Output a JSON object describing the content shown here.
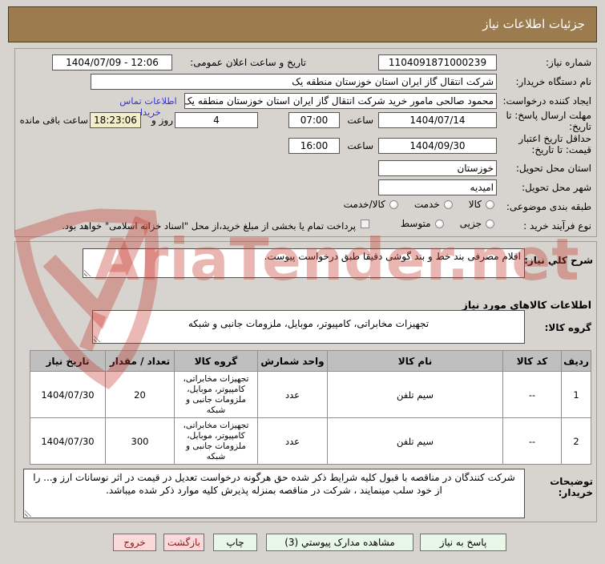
{
  "title": "جزئیات اطلاعات نیاز",
  "watermark": {
    "text": "AriaTender.net"
  },
  "form": {
    "need_number_label": "شماره نیاز:",
    "need_number": "1104091871000239",
    "announce_label": "تاریخ و ساعت اعلان عمومی:",
    "announce_value": "1404/07/09 - 12:06",
    "buyer_org_label": "نام دستگاه خریدار:",
    "buyer_org": "شرکت انتقال گاز ایران  استان خوزستان منطقه یک",
    "creator_label": "ایجاد کننده درخواست:",
    "creator": "محمود صالحی مامور خرید شرکت انتقال گاز ایران  استان خوزستان منطقه یک",
    "contact_link": "اطلاعات تماس خریدار",
    "deadline_label": "مهلت ارسال پاسخ: تا تاریخ:",
    "deadline_date": "1404/07/14",
    "hour_label": "ساعت",
    "deadline_time": "07:00",
    "days_value": "4",
    "days_label": "روز و",
    "remaining_time": "18:23:06",
    "remaining_label": "ساعت باقی مانده",
    "validity_label": "حداقل تاریخ اعتبار قیمت: تا تاریخ:",
    "validity_date": "1404/09/30",
    "validity_time": "16:00",
    "province_label": "استان محل تحویل:",
    "province": "خوزستان",
    "city_label": "شهر محل تحویل:",
    "city": "امیدیه",
    "classification_label": "طبقه بندی موضوعی:",
    "class_options": [
      "کالا",
      "خدمت",
      "کالا/خدمت"
    ],
    "process_label": "نوع فرآیند خرید :",
    "process_options": [
      "جزیی",
      "متوسط"
    ],
    "treasury_checkbox": "پرداخت تمام یا بخشی از مبلغ خرید،از محل \"اسناد خزانه اسلامی\" خواهد بود."
  },
  "need_desc": {
    "label": "شرح كلي نياز:",
    "value": "اقلام مصرفی بند خط و بند گوشی دقیقا طبق درخواست پیوست."
  },
  "goods_section": {
    "header": "اطلاعات کالاهاي مورد نیاز",
    "group_label": "گروه کالا:",
    "group_value": "تجهیزات مخابراتی، کامپیوتر، موبایل، ملزومات جانبی و شبکه"
  },
  "table": {
    "headers": [
      "ردیف",
      "کد کالا",
      "نام کالا",
      "واحد شمارش",
      "گروه کالا",
      "تعداد / مقدار",
      "تاریخ نیاز"
    ],
    "rows": [
      [
        "1",
        "--",
        "سیم تلفن",
        "عدد",
        "تجهیزات مخابراتی، کامپیوتر، موبایل، ملزومات جانبی و شبکه",
        "20",
        "1404/07/30"
      ],
      [
        "2",
        "--",
        "سیم تلفن",
        "عدد",
        "تجهیزات مخابراتی، کامپیوتر، موبایل، ملزومات جانبی و شبکه",
        "300",
        "1404/07/30"
      ]
    ]
  },
  "notes": {
    "label": "توضیحات خریدار:",
    "value": "شرکت کنندگان در مناقصه با قبول کلیه شرایط ذکر شده حق هرگونه درخواست تعدیل در قیمت در اثر نوسانات ارز و... را از خود سلب مینمایند ، شرکت در مناقصه بمنزله پذیرش کلیه موارد ذکر شده میباشد."
  },
  "buttons": {
    "respond": "پاسخ به نیاز",
    "attachments": "مشاهده مدارک پیوستي (3)",
    "print": "چاپ",
    "back": "بازگشت",
    "exit": "خروج"
  },
  "colors": {
    "titlebar": "#9c7c4e",
    "page_bg": "#d7d4cf",
    "remaining_bg": "#f2efca",
    "link": "#3434d6",
    "button_green": "#e9f7e9",
    "button_pink": "#f9d9d9",
    "watermark": "#c43e32"
  }
}
